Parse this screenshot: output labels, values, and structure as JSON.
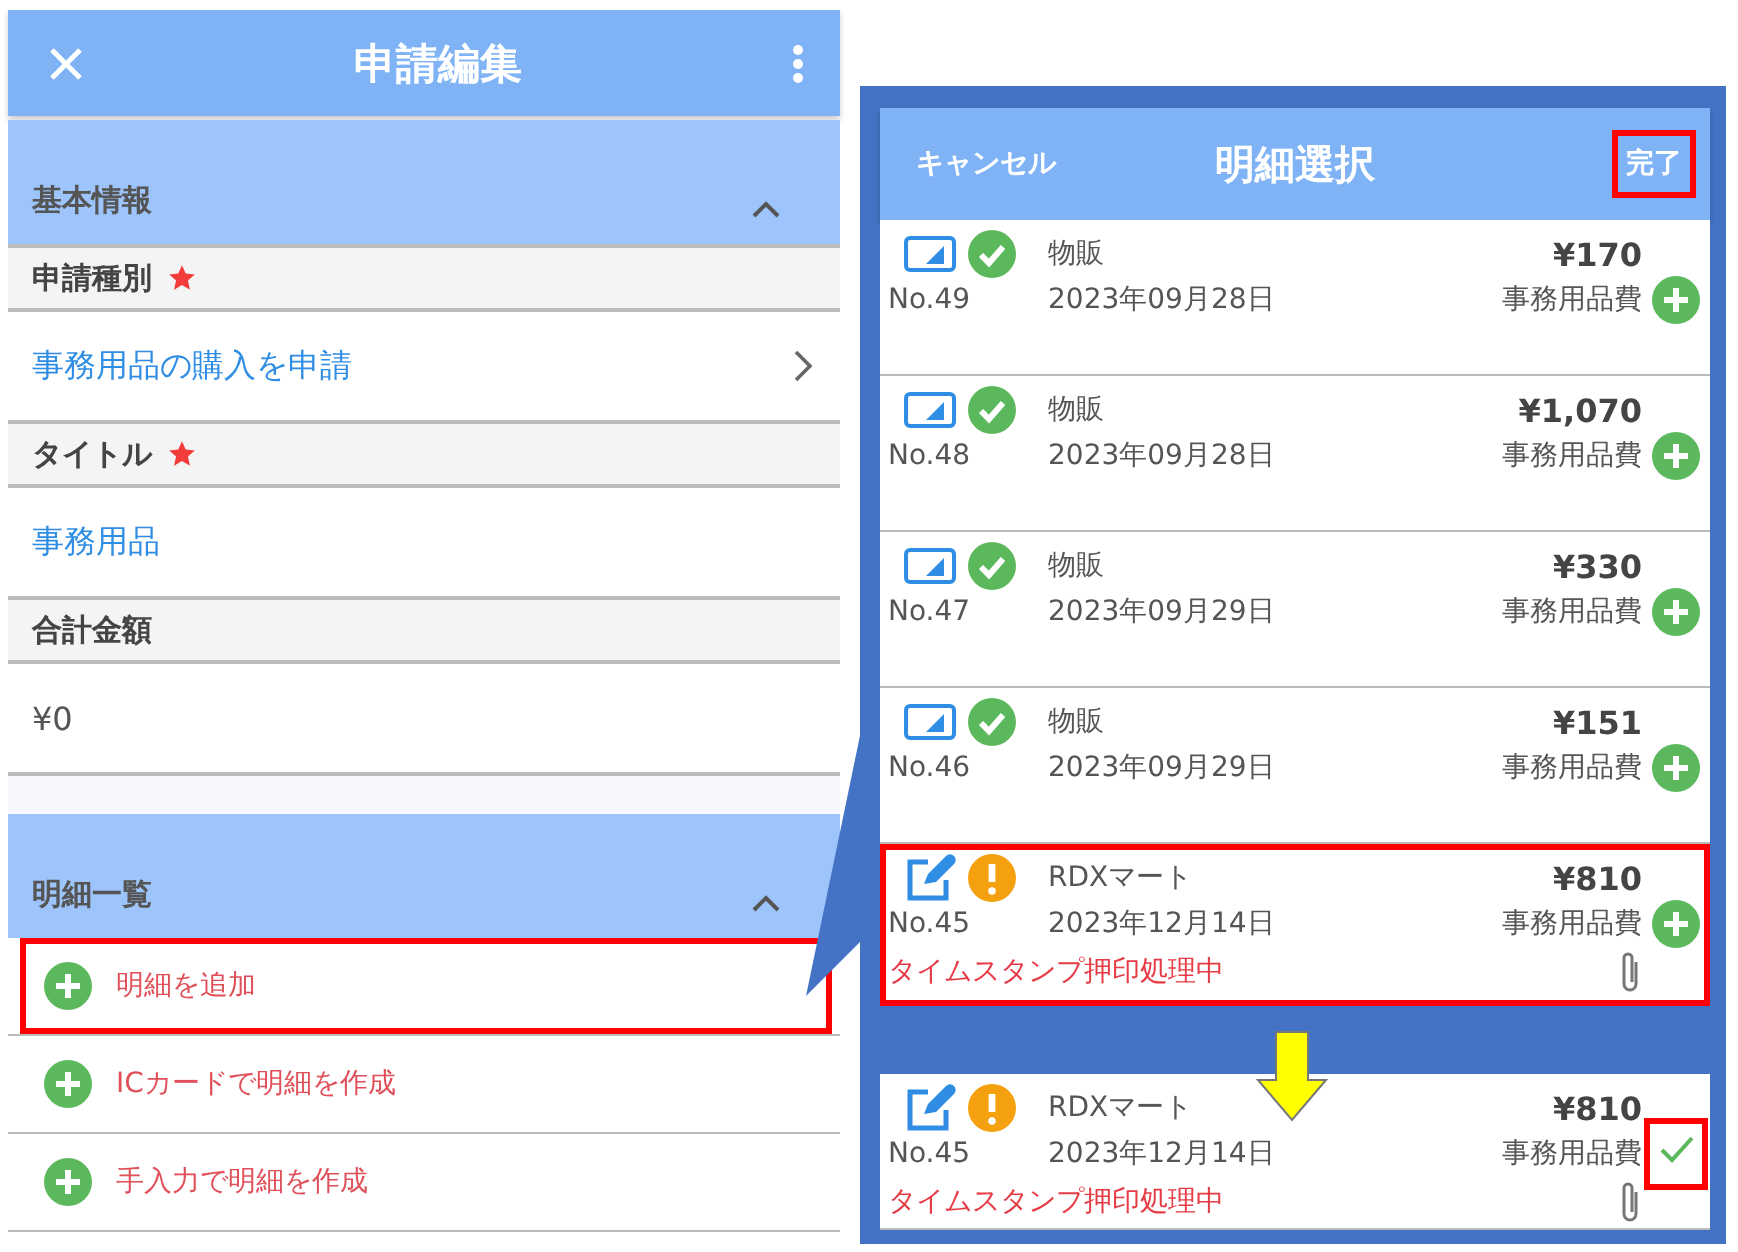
{
  "edit_screen": {
    "title": "申請編集",
    "sections": [
      {
        "title": "基本情報",
        "expanded": true,
        "fields": [
          {
            "label": "申請種別",
            "required": true,
            "kind": "select",
            "value": "事務用品の購入を申請"
          },
          {
            "label": "タイトル",
            "required": true,
            "kind": "text",
            "value": "事務用品"
          },
          {
            "label": "合計金額",
            "required": false,
            "kind": "amount",
            "value": "¥0"
          }
        ]
      },
      {
        "title": "明細一覧",
        "expanded": true,
        "actions": [
          {
            "label": "明細を追加",
            "highlighted": true
          },
          {
            "label": "ICカードで明細を作成",
            "highlighted": false
          },
          {
            "label": "手入力で明細を作成",
            "highlighted": false
          }
        ]
      }
    ]
  },
  "select_screen": {
    "cancel": "キャンセル",
    "title": "明細選択",
    "done": "完了",
    "done_highlighted": true,
    "items": [
      {
        "kind": "card",
        "warning": false,
        "merchant": "物販",
        "amount": "¥170",
        "no": "No.49",
        "date": "2023年09月28日",
        "category": "事務用品費",
        "attachment": false,
        "selected": false,
        "highlighted": false
      },
      {
        "kind": "card",
        "warning": false,
        "merchant": "物販",
        "amount": "¥1,070",
        "no": "No.48",
        "date": "2023年09月28日",
        "category": "事務用品費",
        "attachment": false,
        "selected": false,
        "highlighted": false
      },
      {
        "kind": "card",
        "warning": false,
        "merchant": "物販",
        "amount": "¥330",
        "no": "No.47",
        "date": "2023年09月29日",
        "category": "事務用品費",
        "attachment": false,
        "selected": false,
        "highlighted": false
      },
      {
        "kind": "card",
        "warning": false,
        "merchant": "物販",
        "amount": "¥151",
        "no": "No.46",
        "date": "2023年09月29日",
        "category": "事務用品費",
        "attachment": false,
        "selected": false,
        "highlighted": false
      },
      {
        "kind": "manual",
        "warning": true,
        "merchant": "RDXマート",
        "amount": "¥810",
        "no": "No.45",
        "date": "2023年12月14日",
        "category": "事務用品費",
        "note": "タイムスタンプ押印処理中",
        "attachment": true,
        "selected": false,
        "highlighted": true
      }
    ],
    "result_item": {
      "kind": "manual",
      "warning": true,
      "merchant": "RDXマート",
      "amount": "¥810",
      "no": "No.45",
      "date": "2023年12月14日",
      "category": "事務用品費",
      "note": "タイムスタンプ押印処理中",
      "attachment": true,
      "selected": true,
      "highlighted": false,
      "check_highlighted": true
    }
  }
}
